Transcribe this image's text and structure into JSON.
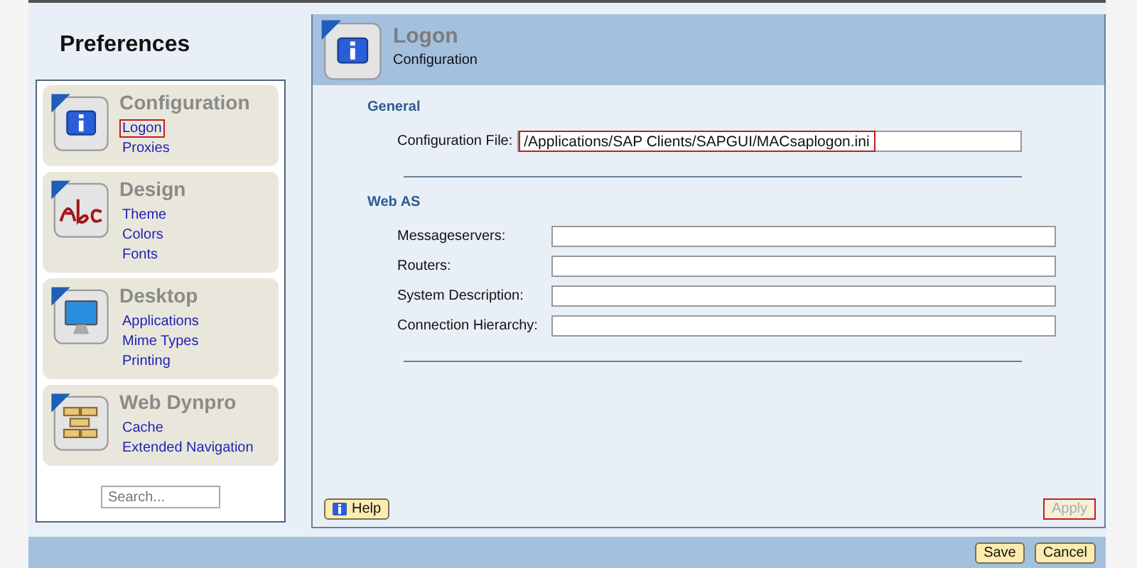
{
  "sidebar": {
    "title": "Preferences",
    "groups": [
      {
        "kind": "info",
        "title": "Configuration",
        "items": [
          {
            "label": "Logon",
            "selected": true
          },
          {
            "label": "Proxies",
            "selected": false
          }
        ]
      },
      {
        "kind": "abc",
        "title": "Design",
        "items": [
          {
            "label": "Theme",
            "selected": false
          },
          {
            "label": "Colors",
            "selected": false
          },
          {
            "label": "Fonts",
            "selected": false
          }
        ]
      },
      {
        "kind": "monitor",
        "title": "Desktop",
        "items": [
          {
            "label": "Applications",
            "selected": false
          },
          {
            "label": "Mime Types",
            "selected": false
          },
          {
            "label": "Printing",
            "selected": false
          }
        ]
      },
      {
        "kind": "bricks",
        "title": "Web Dynpro",
        "items": [
          {
            "label": "Cache",
            "selected": false
          },
          {
            "label": "Extended Navigation",
            "selected": false
          }
        ]
      }
    ],
    "search": {
      "placeholder": "Search..."
    }
  },
  "panel": {
    "kind": "info",
    "title": "Logon",
    "subtitle": "Configuration",
    "sections": [
      {
        "title": "General",
        "fields": [
          {
            "label": "Configuration File:",
            "value": "/Applications/SAP Clients/SAPGUI/MACsaplogon.ini",
            "highlighted": true
          }
        ]
      },
      {
        "title": "Web AS",
        "fields": [
          {
            "label": "Messageservers:",
            "highlighted": false
          },
          {
            "label": "Routers:",
            "highlighted": false
          },
          {
            "label": "System Description:",
            "highlighted": false
          },
          {
            "label": "Connection Hierarchy:",
            "highlighted": false
          }
        ]
      }
    ],
    "help_button": "Help",
    "apply_button": {
      "label": "Apply",
      "disabled": true,
      "highlighted": true
    }
  },
  "footer_buttons": [
    "Save",
    "Cancel"
  ]
}
